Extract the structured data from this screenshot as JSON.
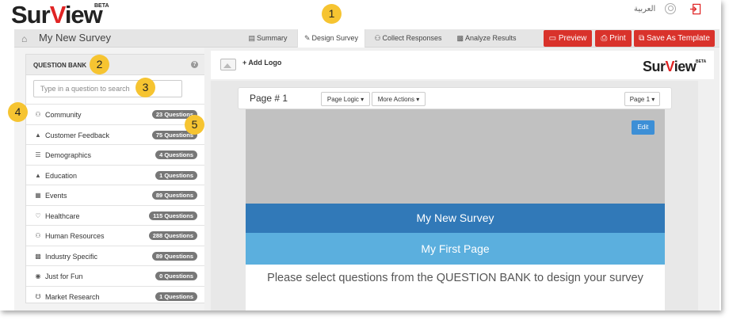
{
  "brand": {
    "logo_prefix": "Sur",
    "logo_accent": "V",
    "logo_suffix": "iew",
    "beta": "BETA"
  },
  "topbar": {
    "language": "العربية",
    "user_icon": "user-circle-icon",
    "signout_icon": "sign-out-icon"
  },
  "nav": {
    "home_icon": "home-icon",
    "survey_title": "My New Survey",
    "tabs": [
      {
        "label": "Summary",
        "icon": "list-icon"
      },
      {
        "label": "Design Survey",
        "icon": "pencil-icon",
        "active": true
      },
      {
        "label": "Collect Responses",
        "icon": "users-icon"
      },
      {
        "label": "Analyze Results",
        "icon": "bar-chart-icon"
      }
    ],
    "actions": [
      {
        "label": "Preview",
        "icon": "monitor-icon"
      },
      {
        "label": "Print",
        "icon": "printer-icon"
      },
      {
        "label": "Save As Template",
        "icon": "copy-icon"
      }
    ]
  },
  "question_bank": {
    "title": "QUESTION BANK",
    "help_icon": "question-circle-icon",
    "search_placeholder": "Type in a question to search",
    "categories": [
      {
        "label": "Community",
        "count": "23 Questions",
        "icon": "users-icon"
      },
      {
        "label": "Customer Feedback",
        "count": "75 Questions",
        "icon": "thumbs-up-icon"
      },
      {
        "label": "Demographics",
        "count": "4 Questions",
        "icon": "database-icon"
      },
      {
        "label": "Education",
        "count": "1 Questions",
        "icon": "graduation-cap-icon"
      },
      {
        "label": "Events",
        "count": "89 Questions",
        "icon": "calendar-icon"
      },
      {
        "label": "Healthcare",
        "count": "115 Questions",
        "icon": "heartbeat-icon"
      },
      {
        "label": "Human Resources",
        "count": "288 Questions",
        "icon": "users-icon"
      },
      {
        "label": "Industry Specific",
        "count": "89 Questions",
        "icon": "industry-icon"
      },
      {
        "label": "Just for Fun",
        "count": "0 Questions",
        "icon": "gamepad-icon"
      },
      {
        "label": "Market Research",
        "count": "1 Questions",
        "icon": "shopping-cart-icon"
      }
    ]
  },
  "designer": {
    "add_logo": "+ Add Logo",
    "page_label": "Page # 1",
    "page_logic": "Page Logic",
    "more_actions": "More Actions",
    "page_select": "Page 1",
    "edit": "Edit",
    "survey_title": "My New Survey",
    "page_title": "My First Page",
    "prompt": "Please select questions from the QUESTION BANK to design your survey"
  },
  "callouts": [
    "1",
    "2",
    "3",
    "4",
    "5"
  ],
  "colors": {
    "brand_red": "#d9322b",
    "banner_blue": "#3179b8",
    "page_blue": "#5bafde",
    "callout_yellow": "#f6c431"
  }
}
